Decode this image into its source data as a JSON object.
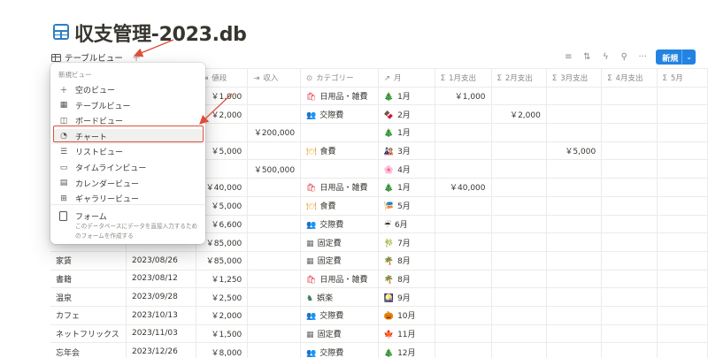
{
  "page": {
    "title": "収支管理-2023.db"
  },
  "view": {
    "label": "テーブルビュー",
    "add": "+"
  },
  "toolbar": {
    "new_label": "新規",
    "new_dropdown": "⌄",
    "icons": [
      "filter-icon",
      "sort-icon",
      "automation-icon",
      "search-icon",
      "more-icon"
    ]
  },
  "menu": {
    "header": "新規ビュー",
    "items": [
      {
        "label": "空のビュー",
        "icon": "＋"
      },
      {
        "label": "テーブルビュー",
        "icon": "▦"
      },
      {
        "label": "ボードビュー",
        "icon": "◫"
      },
      {
        "label": "チャート",
        "icon": "◔"
      },
      {
        "label": "リストビュー",
        "icon": "☰"
      },
      {
        "label": "タイムラインビュー",
        "icon": "▭"
      },
      {
        "label": "カレンダービュー",
        "icon": "▤"
      },
      {
        "label": "ギャラリービュー",
        "icon": "⊞"
      }
    ],
    "form_title": "フォーム",
    "form_desc": "このデータベースにデータを直接入力するためのフォームを作成する"
  },
  "columns": [
    {
      "label": "",
      "icon": ""
    },
    {
      "label": "",
      "icon": ""
    },
    {
      "label": "値段",
      "icon": "⇥"
    },
    {
      "label": "収入",
      "icon": "⇥"
    },
    {
      "label": "カテゴリー",
      "icon": "⊙"
    },
    {
      "label": "月",
      "icon": "↗"
    },
    {
      "label": "1月支出",
      "icon": "Σ"
    },
    {
      "label": "2月支出",
      "icon": "Σ"
    },
    {
      "label": "3月支出",
      "icon": "Σ"
    },
    {
      "label": "4月支出",
      "icon": "Σ"
    },
    {
      "label": "5月",
      "icon": "Σ"
    }
  ],
  "rows": [
    {
      "name": "",
      "date": "",
      "price": "￥1,000",
      "income": "",
      "category": "日用品・雑費",
      "cat_emoji": "🛍",
      "cat_color": "#e3484f",
      "month": "1月",
      "month_emoji": "🎄",
      "m1": "￥1,000",
      "m2": "",
      "m3": "",
      "m4": "",
      "m5": ""
    },
    {
      "name": "",
      "date": "",
      "price": "￥2,000",
      "income": "",
      "category": "交際費",
      "cat_emoji": "👥",
      "cat_color": "#d44a8c",
      "month": "2月",
      "month_emoji": "🍫",
      "m1": "",
      "m2": "￥2,000",
      "m3": "",
      "m4": "",
      "m5": ""
    },
    {
      "name": "",
      "date": "",
      "price": "",
      "income": "￥200,000",
      "category": "",
      "cat_emoji": "",
      "cat_color": "",
      "month": "1月",
      "month_emoji": "🎄",
      "m1": "",
      "m2": "",
      "m3": "",
      "m4": "",
      "m5": ""
    },
    {
      "name": "",
      "date": "",
      "price": "￥5,000",
      "income": "",
      "category": "食費",
      "cat_emoji": "🍽",
      "cat_color": "#e4a02c",
      "month": "3月",
      "month_emoji": "🎎",
      "m1": "",
      "m2": "",
      "m3": "￥5,000",
      "m4": "",
      "m5": ""
    },
    {
      "name": "",
      "date": "",
      "price": "",
      "income": "￥500,000",
      "category": "",
      "cat_emoji": "",
      "cat_color": "",
      "month": "4月",
      "month_emoji": "🌸",
      "m1": "",
      "m2": "",
      "m3": "",
      "m4": "",
      "m5": ""
    },
    {
      "name": "",
      "date": "",
      "price": "￥40,000",
      "income": "",
      "category": "日用品・雑費",
      "cat_emoji": "🛍",
      "cat_color": "#e3484f",
      "month": "1月",
      "month_emoji": "🎄",
      "m1": "￥40,000",
      "m2": "",
      "m3": "",
      "m4": "",
      "m5": ""
    },
    {
      "name": "",
      "date": "",
      "price": "￥5,000",
      "income": "",
      "category": "食費",
      "cat_emoji": "🍽",
      "cat_color": "#e4a02c",
      "month": "5月",
      "month_emoji": "🎏",
      "m1": "",
      "m2": "",
      "m3": "",
      "m4": "",
      "m5": ""
    },
    {
      "name": "",
      "date": "",
      "price": "￥6,600",
      "income": "",
      "category": "交際費",
      "cat_emoji": "👥",
      "cat_color": "#d44a8c",
      "month": "6月",
      "month_emoji": "☔",
      "m1": "",
      "m2": "",
      "m3": "",
      "m4": "",
      "m5": ""
    },
    {
      "name": "",
      "date": "",
      "price": "￥85,000",
      "income": "",
      "category": "固定費",
      "cat_emoji": "▦",
      "cat_color": "#6b6b6b",
      "month": "7月",
      "month_emoji": "🎋",
      "m1": "",
      "m2": "",
      "m3": "",
      "m4": "",
      "m5": ""
    },
    {
      "name": "家賃",
      "date": "2023/08/26",
      "price": "￥85,000",
      "income": "",
      "category": "固定費",
      "cat_emoji": "▦",
      "cat_color": "#6b6b6b",
      "month": "8月",
      "month_emoji": "🌴",
      "m1": "",
      "m2": "",
      "m3": "",
      "m4": "",
      "m5": ""
    },
    {
      "name": "書籍",
      "date": "2023/08/12",
      "price": "￥1,250",
      "income": "",
      "category": "日用品・雑費",
      "cat_emoji": "🛍",
      "cat_color": "#e3484f",
      "month": "8月",
      "month_emoji": "🌴",
      "m1": "",
      "m2": "",
      "m3": "",
      "m4": "",
      "m5": ""
    },
    {
      "name": "温泉",
      "date": "2023/09/28",
      "price": "￥2,500",
      "income": "",
      "category": "娯楽",
      "cat_emoji": "♞",
      "cat_color": "#2f7d4f",
      "month": "9月",
      "month_emoji": "🎑",
      "m1": "",
      "m2": "",
      "m3": "",
      "m4": "",
      "m5": ""
    },
    {
      "name": "カフェ",
      "date": "2023/10/13",
      "price": "￥2,000",
      "income": "",
      "category": "交際費",
      "cat_emoji": "👥",
      "cat_color": "#d44a8c",
      "month": "10月",
      "month_emoji": "🎃",
      "m1": "",
      "m2": "",
      "m3": "",
      "m4": "",
      "m5": ""
    },
    {
      "name": "ネットフリックス",
      "date": "2023/11/03",
      "price": "￥1,500",
      "income": "",
      "category": "固定費",
      "cat_emoji": "▦",
      "cat_color": "#6b6b6b",
      "month": "11月",
      "month_emoji": "🍁",
      "m1": "",
      "m2": "",
      "m3": "",
      "m4": "",
      "m5": ""
    },
    {
      "name": "忘年会",
      "date": "2023/12/26",
      "price": "￥8,000",
      "income": "",
      "category": "交際費",
      "cat_emoji": "👥",
      "cat_color": "#d44a8c",
      "month": "12月",
      "month_emoji": "🎄",
      "m1": "",
      "m2": "",
      "m3": "",
      "m4": "",
      "m5": ""
    }
  ],
  "colors": {
    "accent": "#2383e2",
    "annotation": "#e04e39",
    "db_icon": "#2e7fc5"
  }
}
